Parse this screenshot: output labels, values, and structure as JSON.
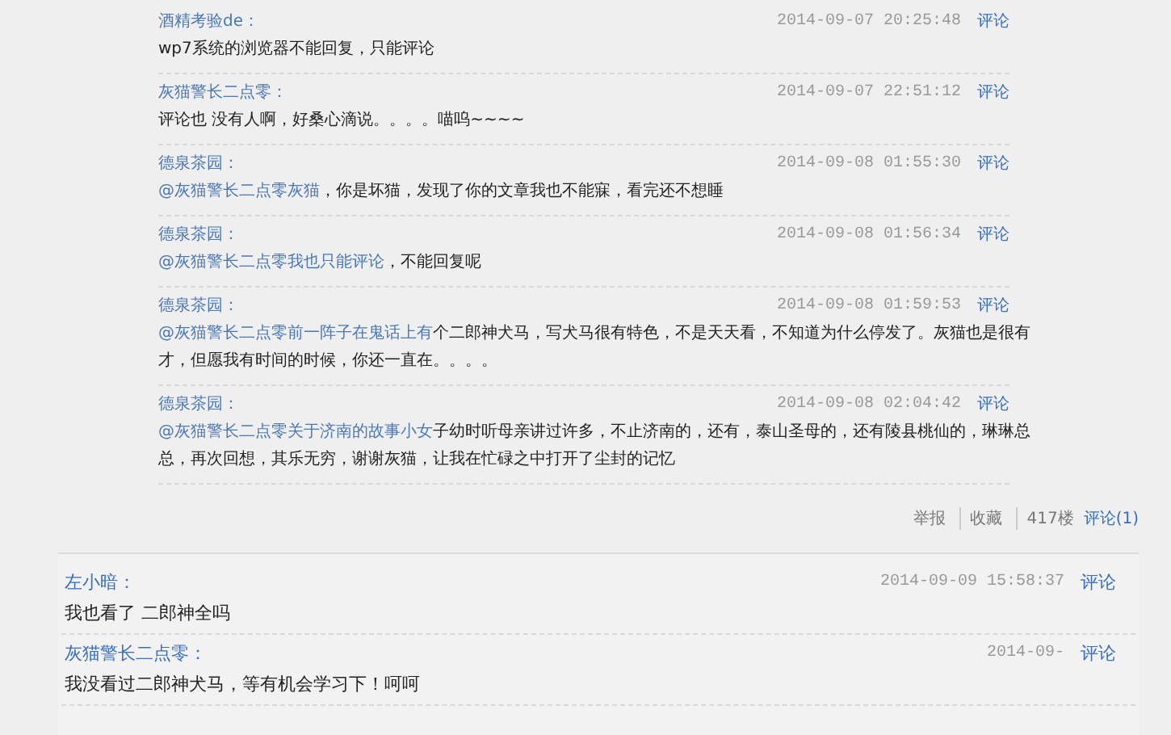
{
  "quoted_comments": [
    {
      "author": "酒精考验de：",
      "time": "2014-09-07 20:25:48",
      "action": "评论",
      "segments": [
        {
          "kind": "plain",
          "text": "wp7系统的浏览器不能回复，只能评论"
        }
      ]
    },
    {
      "author": "灰猫警长二点零：",
      "time": "2014-09-07 22:51:12",
      "action": "评论",
      "segments": [
        {
          "kind": "plain",
          "text": "评论也 没有人啊，好桑心滴说。。。。喵呜~~~~"
        }
      ]
    },
    {
      "author": "德泉茶园：",
      "time": "2014-09-08 01:55:30",
      "action": "评论",
      "segments": [
        {
          "kind": "mention",
          "text": "@灰猫警长二点零灰猫"
        },
        {
          "kind": "plain",
          "text": "，你是坏猫，发现了你的文章我也不能寐，看完还不想睡"
        }
      ]
    },
    {
      "author": "德泉茶园：",
      "time": "2014-09-08 01:56:34",
      "action": "评论",
      "segments": [
        {
          "kind": "mention",
          "text": "@灰猫警长二点零我也只能评论"
        },
        {
          "kind": "plain",
          "text": "，不能回复呢"
        }
      ]
    },
    {
      "author": "德泉茶园：",
      "time": "2014-09-08 01:59:53",
      "action": "评论",
      "segments": [
        {
          "kind": "mention",
          "text": "@灰猫警长二点零前一阵子在鬼话上有"
        },
        {
          "kind": "plain",
          "text": "个二郎神犬马，写犬马很有特色，不是天天看，不知道为什么停发了。灰猫也是很有才，但愿我有时间的时候，你还一直在。。。。"
        }
      ]
    },
    {
      "author": "德泉茶园：",
      "time": "2014-09-08 02:04:42",
      "action": "评论",
      "segments": [
        {
          "kind": "mention",
          "text": "@灰猫警长二点零关于济南的故事小女"
        },
        {
          "kind": "plain",
          "text": "子幼时听母亲讲过许多，不止济南的，还有，泰山圣母的，还有陵县桃仙的，琳琳总总，再次回想，其乐无穷，谢谢灰猫，让我在忙碌之中打开了尘封的记忆"
        }
      ]
    }
  ],
  "post_actions": {
    "report": "举报",
    "favorite": "收藏",
    "floor": "417楼",
    "comments": "评论(1)"
  },
  "replies": [
    {
      "author": "左小暗：",
      "time": "2014-09-09 15:58:37",
      "action": "评论",
      "text": "我也看了 二郎神全吗"
    },
    {
      "author": "灰猫警长二点零：",
      "time": "2014-09-",
      "action": "评论",
      "text": "我没看过二郎神犬马，等有机会学习下！呵呵"
    }
  ]
}
